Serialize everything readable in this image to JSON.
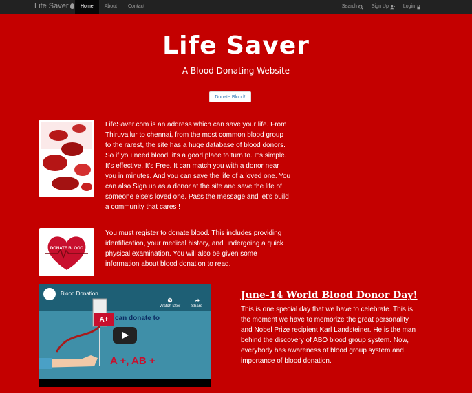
{
  "navbar": {
    "brand": "Life Saver",
    "left_items": [
      {
        "label": "Home",
        "active": true
      },
      {
        "label": "About",
        "active": false
      },
      {
        "label": "Contact",
        "active": false
      }
    ],
    "right_items": [
      {
        "label": "Search",
        "icon": "search-icon"
      },
      {
        "label": "Sign Up",
        "icon": "user-plus-icon"
      },
      {
        "label": "Login",
        "icon": "lock-icon"
      }
    ]
  },
  "hero": {
    "title": "Life Saver",
    "subtitle": "A Blood Donating Website",
    "cta_label": "Donate Blood!"
  },
  "sections": {
    "intro_text": "LifeSaver.com is an address which can save your life. From Thiruvallur to chennai, from the most common blood group to the rarest, the site has a huge database of blood donors. So if you need blood, it's a good place to turn to. It's simple. It's effective. It's Free. It can match you with a donor near you in minutes. And you can save the life of a loved one. You can also Sign up as a donor at the site and save the life of someone else's loved one. Pass the message and let's build a community that cares !",
    "register_text": "You must register to donate blood. This includes providing identification, your medical history, and undergoing a quick physical examination. You will also be given some information about blood donation to read.",
    "donate_badge": "DONATE BLOOD",
    "video": {
      "title": "Blood Donation",
      "watch_later": "Watch later",
      "share": "Share",
      "blood_group": "A+",
      "can_donate_to": "can donate to",
      "groups": "A +, AB +"
    },
    "event_title": "June-14 World Blood Donor Day!",
    "event_text": "This is one special day that we have to celebrate. This is the moment we have to memorize the great personality and Nobel Prize recipient Karl Landsteiner. He is the man behind the discovery of ABO blood group system. Now, everybody has awareness of blood group system and importance of blood donation."
  }
}
